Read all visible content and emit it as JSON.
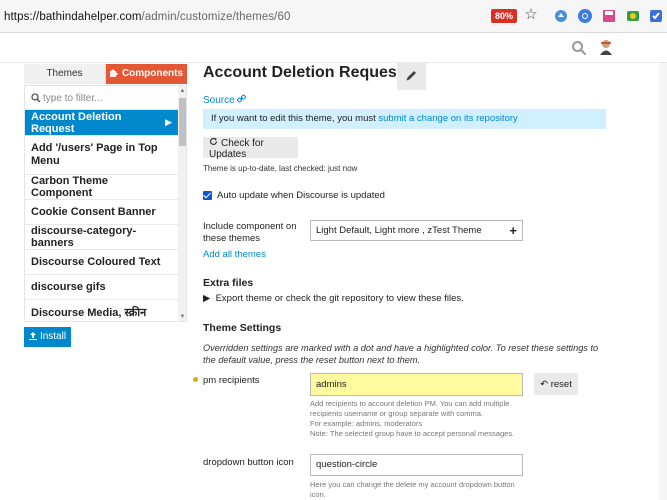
{
  "browser": {
    "url_host": "https://bathindahelper.com",
    "url_path": "/admin/customize/themes/60",
    "zoom": "80%",
    "icons": [
      "star-icon",
      "extension-icon",
      "chrome-icon",
      "save-icon",
      "extension-icon",
      "extension-icon"
    ]
  },
  "header": {
    "icons": [
      "search-icon",
      "avatar"
    ]
  },
  "sidebar": {
    "tab_themes": "Themes",
    "tab_components": "Components",
    "filter_placeholder": "type to filter...",
    "items": [
      {
        "label": "Account Deletion Request",
        "active": true
      },
      {
        "label": "Add '/users' Page in Top Menu",
        "active": false
      },
      {
        "label": "Carbon Theme Component",
        "active": false
      },
      {
        "label": "Cookie Consent Banner",
        "active": false
      },
      {
        "label": "discourse-category-banners",
        "active": false
      },
      {
        "label": "Discourse Coloured Text",
        "active": false
      },
      {
        "label": "discourse gifs",
        "active": false
      },
      {
        "label": "Discourse Media, स्क्रीन",
        "active": false
      }
    ],
    "install_label": "Install"
  },
  "main": {
    "title": "Account Deletion Request",
    "source_label": "Source",
    "info_text": "If you want to edit this theme, you must ",
    "info_link": "submit a change on its repository",
    "check_updates_label": "Check for Updates",
    "up_to_date_text": "Theme is up-to-date, last checked: just now",
    "auto_update_label": "Auto update when Discourse is updated",
    "auto_update_checked": true,
    "include_label": "Include component on these themes",
    "include_value": "Light Default, Light more , zTest Theme",
    "add_all_label": "Add all themes",
    "extra_files_heading": "Extra files",
    "extra_files_text": "Export theme or check the git repository to view these files.",
    "theme_settings_heading": "Theme Settings",
    "settings_desc": "Overridden settings are marked with a dot and have a highlighted color. To reset these settings to the default value, press the reset button next to them.",
    "settings": [
      {
        "label": "pm recipients",
        "value": "admins",
        "reset_label": "reset",
        "help": [
          "Add recipients to account deletion PM. You can add multiple",
          "recipients username or group separate with comma.",
          "For example: admins, moderators",
          "Note: The selected group have to accept personal messages."
        ]
      },
      {
        "label": "dropdown button icon",
        "value": "question-circle",
        "help": [
          "Here you can change the delete my account dropdown button",
          "icon."
        ]
      }
    ]
  },
  "colors": {
    "accent": "#0088cc",
    "components_tab": "#e45735",
    "info_bg": "#d1f0ff",
    "highlight": "#fffa9e",
    "override_dot": "#d4b106"
  }
}
